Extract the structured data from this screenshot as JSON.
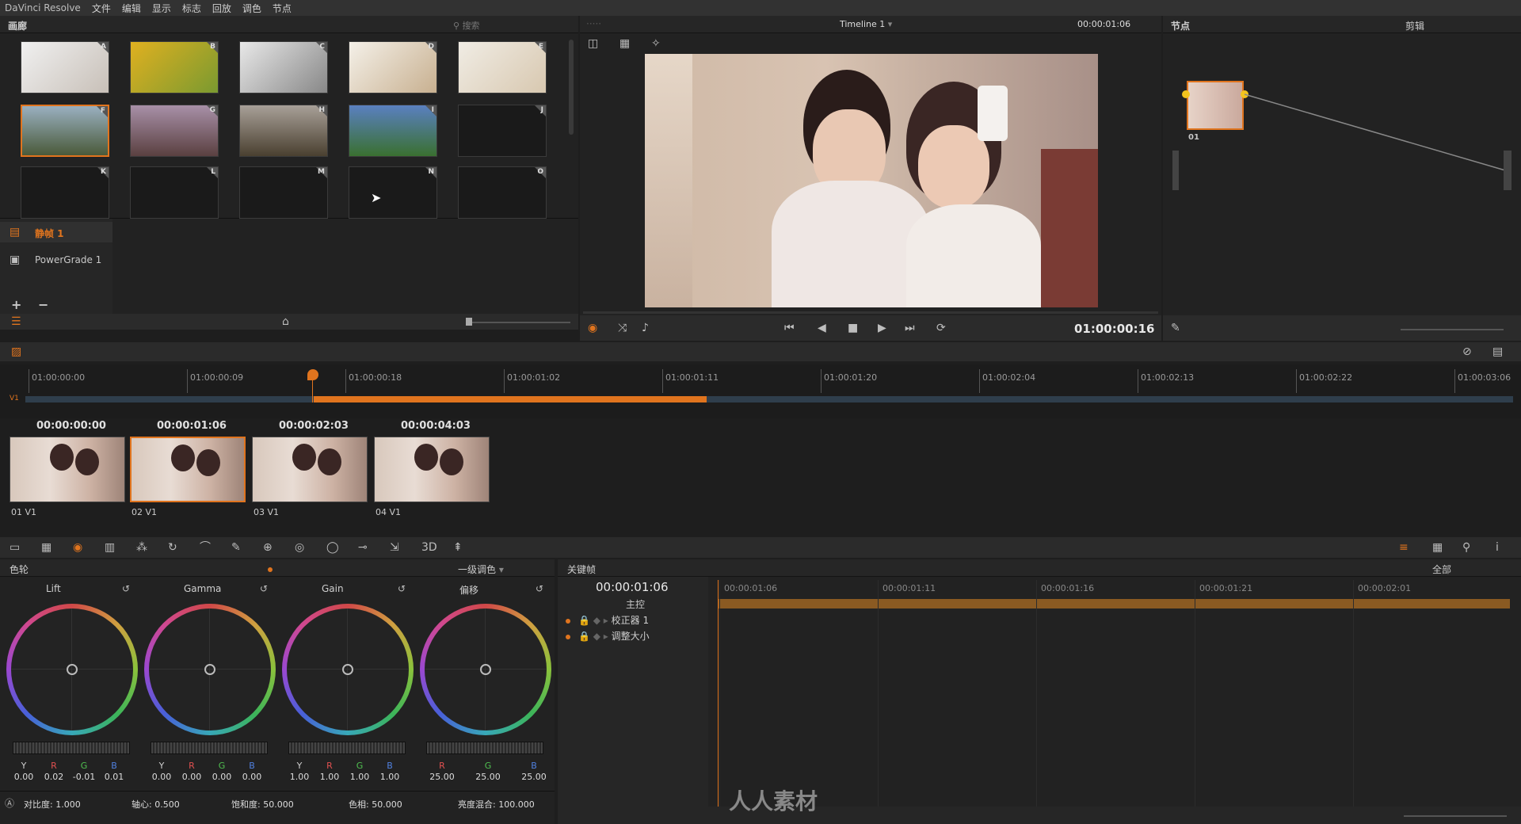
{
  "menubar": {
    "app_name": "DaVinci Resolve",
    "items": [
      "文件",
      "编辑",
      "显示",
      "标志",
      "回放",
      "调色",
      "节点"
    ]
  },
  "gallery": {
    "title": "画廊",
    "search_placeholder": "搜索",
    "still_tags": [
      "A",
      "B",
      "C",
      "D",
      "E",
      "F",
      "G",
      "H",
      "I",
      "J",
      "K",
      "L",
      "M",
      "N",
      "O"
    ],
    "albums": [
      {
        "label": "静帧 1",
        "active": true
      },
      {
        "label": "PowerGrade 1",
        "active": false
      }
    ],
    "add": "+",
    "remove": "−"
  },
  "viewer": {
    "dots": "·····",
    "timeline_name": "Timeline 1",
    "source_tc": "00:00:01:06",
    "record_tc": "01:00:00:16"
  },
  "nodes": {
    "title": "节点",
    "mode": "剪辑",
    "node_label": "01"
  },
  "timeline": {
    "track": "V1",
    "ruler": [
      "01:00:00:00",
      "01:00:00:09",
      "01:00:00:18",
      "01:00:01:02",
      "01:00:01:11",
      "01:00:01:20",
      "01:00:02:04",
      "01:00:02:13",
      "01:00:02:22",
      "01:00:03:06"
    ],
    "clips": [
      {
        "tc": "00:00:00:00",
        "num": "01",
        "track": "V1"
      },
      {
        "tc": "00:00:01:06",
        "num": "02",
        "track": "V1"
      },
      {
        "tc": "00:00:02:03",
        "num": "03",
        "track": "V1"
      },
      {
        "tc": "00:00:04:03",
        "num": "04",
        "track": "V1"
      }
    ]
  },
  "color": {
    "title": "色轮",
    "mode": "一级调色",
    "wheels": [
      {
        "name": "Lift",
        "vals": [
          "0.00",
          "0.02",
          "-0.01",
          "0.01"
        ]
      },
      {
        "name": "Gamma",
        "vals": [
          "0.00",
          "0.00",
          "0.00",
          "0.00"
        ]
      },
      {
        "name": "Gain",
        "vals": [
          "1.00",
          "1.00",
          "1.00",
          "1.00"
        ]
      },
      {
        "name": "偏移",
        "vals": [
          "25.00",
          "25.00",
          "25.00"
        ]
      }
    ],
    "channel_letters": [
      "Y",
      "R",
      "G",
      "B"
    ],
    "footer": {
      "contrast": "对比度: 1.000",
      "pivot": "轴心: 0.500",
      "sat": "饱和度: 50.000",
      "hue": "色相: 50.000",
      "lummix": "亮度混合: 100.000"
    }
  },
  "keyframes": {
    "title": "关键帧",
    "filter": "全部",
    "tc": "00:00:01:06",
    "master": "主控",
    "rows": [
      "校正器 1",
      "调整大小"
    ],
    "ruler": [
      "00:00:01:06",
      "00:00:01:11",
      "00:00:01:16",
      "00:00:01:21",
      "00:00:02:01"
    ]
  },
  "watermark": "人人素材",
  "colors": {
    "accent": "#e0741e",
    "panel": "#222222",
    "bg": "#1e1e1e"
  }
}
